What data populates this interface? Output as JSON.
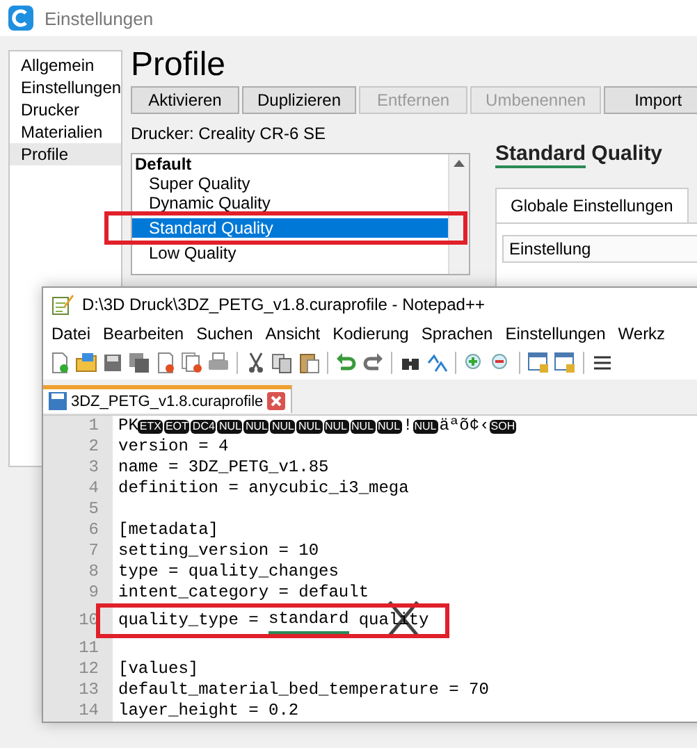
{
  "settings_window": {
    "title": "Einstellungen",
    "sidebar": [
      {
        "label": "Allgemein",
        "selected": false
      },
      {
        "label": "Einstellungen",
        "selected": false
      },
      {
        "label": "Drucker",
        "selected": false
      },
      {
        "label": "Materialien",
        "selected": false
      },
      {
        "label": "Profile",
        "selected": true
      }
    ],
    "heading": "Profile",
    "buttons": [
      {
        "label": "Aktivieren",
        "disabled": false
      },
      {
        "label": "Duplizieren",
        "disabled": false
      },
      {
        "label": "Entfernen",
        "disabled": true
      },
      {
        "label": "Umbenennen",
        "disabled": true
      },
      {
        "label": "Import",
        "disabled": false
      }
    ],
    "printer_label": "Drucker: Creality CR-6 SE",
    "profiles": [
      {
        "label": "Default",
        "kind": "group",
        "selected": false,
        "boxed": false
      },
      {
        "label": "Super Quality",
        "kind": "item",
        "selected": false,
        "boxed": false
      },
      {
        "label": "Dynamic Quality",
        "kind": "item",
        "selected": false,
        "boxed": false
      },
      {
        "label": "Standard Quality",
        "kind": "item",
        "selected": true,
        "boxed": true
      },
      {
        "label": "Low Quality",
        "kind": "item",
        "selected": false,
        "boxed": false
      }
    ],
    "profile_title": [
      {
        "text": "Standard",
        "underlined": true
      },
      {
        "text": " Quality",
        "underlined": false
      }
    ],
    "tabs": [
      {
        "label": "Globale Einstellungen",
        "selected": true
      }
    ],
    "table_header": "Einstellung"
  },
  "notepad": {
    "title": "D:\\3D Druck\\3DZ_PETG_v1.8.curaprofile - Notepad++",
    "menu": [
      "Datei",
      "Bearbeiten",
      "Suchen",
      "Ansicht",
      "Kodierung",
      "Sprachen",
      "Einstellungen",
      "Werkz"
    ],
    "file_tab": {
      "label": "3DZ_PETG_v1.8.curaprofile",
      "selected": true
    },
    "lines": [
      {
        "number": "1",
        "boxed": false,
        "crossed": false,
        "tokens": [
          {
            "text": "PK",
            "kind": "plain"
          },
          {
            "text": "ETX",
            "kind": "control"
          },
          {
            "text": "EOT",
            "kind": "control"
          },
          {
            "text": "DC4",
            "kind": "control"
          },
          {
            "text": "NUL",
            "kind": "control"
          },
          {
            "text": "NUL",
            "kind": "control"
          },
          {
            "text": "NUL",
            "kind": "control"
          },
          {
            "text": "NUL",
            "kind": "control"
          },
          {
            "text": "NUL",
            "kind": "control"
          },
          {
            "text": "NUL",
            "kind": "control"
          },
          {
            "text": "NUL",
            "kind": "control"
          },
          {
            "text": "!",
            "kind": "plain"
          },
          {
            "text": "NUL",
            "kind": "control"
          },
          {
            "text": "äªõ¢‹",
            "kind": "plain"
          },
          {
            "text": "SOH",
            "kind": "control"
          }
        ]
      },
      {
        "number": "2",
        "boxed": false,
        "crossed": false,
        "tokens": [
          {
            "text": "version = 4",
            "kind": "plain"
          }
        ]
      },
      {
        "number": "3",
        "boxed": false,
        "crossed": false,
        "tokens": [
          {
            "text": "name = 3DZ_PETG_v1.85",
            "kind": "plain"
          }
        ]
      },
      {
        "number": "4",
        "boxed": false,
        "crossed": false,
        "tokens": [
          {
            "text": "definition = anycubic_i3_mega",
            "kind": "plain"
          }
        ]
      },
      {
        "number": "5",
        "boxed": false,
        "crossed": false
      },
      {
        "number": "6",
        "boxed": false,
        "crossed": false,
        "tokens": [
          {
            "text": "[metadata]",
            "kind": "plain"
          }
        ]
      },
      {
        "number": "7",
        "boxed": false,
        "crossed": false,
        "tokens": [
          {
            "text": "setting_version = 10",
            "kind": "plain"
          }
        ]
      },
      {
        "number": "8",
        "boxed": false,
        "crossed": false,
        "tokens": [
          {
            "text": "type = quality_changes",
            "kind": "plain"
          }
        ]
      },
      {
        "number": "9",
        "boxed": false,
        "crossed": false,
        "tokens": [
          {
            "text": "intent_category = default",
            "kind": "plain"
          }
        ]
      },
      {
        "number": "10",
        "boxed": true,
        "crossed": true,
        "tokens": [
          {
            "text": "quality_type = ",
            "kind": "plain"
          },
          {
            "text": "standard",
            "kind": "underlined"
          },
          {
            "text": " quality",
            "kind": "plain"
          }
        ]
      },
      {
        "number": "11",
        "boxed": false,
        "crossed": false
      },
      {
        "number": "12",
        "boxed": false,
        "crossed": false,
        "tokens": [
          {
            "text": "[values]",
            "kind": "plain"
          }
        ]
      },
      {
        "number": "13",
        "boxed": false,
        "crossed": false,
        "tokens": [
          {
            "text": "default_material_bed_temperature = 70",
            "kind": "plain"
          }
        ]
      },
      {
        "number": "14",
        "boxed": false,
        "crossed": false,
        "tokens": [
          {
            "text": "layer_height = 0.2",
            "kind": "plain"
          }
        ]
      }
    ]
  }
}
